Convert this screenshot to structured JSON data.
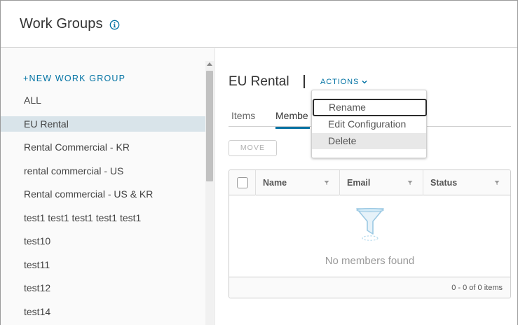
{
  "page": {
    "title": "Work Groups"
  },
  "sidebar": {
    "new_button": "+NEW WORK GROUP",
    "items": [
      {
        "label": "ALL"
      },
      {
        "label": "EU Rental"
      },
      {
        "label": "Rental Commercial - KR"
      },
      {
        "label": "rental commercial - US"
      },
      {
        "label": "Rental commercial - US & KR"
      },
      {
        "label": "test1 test1 test1 test1 test1"
      },
      {
        "label": "test10"
      },
      {
        "label": "test11"
      },
      {
        "label": "test12"
      },
      {
        "label": "test14"
      }
    ],
    "selected_index": 1
  },
  "detail": {
    "title": "EU Rental",
    "actions_label": "ACTIONS",
    "tabs": [
      {
        "label": "Items"
      },
      {
        "label": "Membe"
      }
    ],
    "active_tab_index": 1,
    "move_button": "MOVE",
    "grid": {
      "columns": [
        {
          "label": "Name"
        },
        {
          "label": "Email"
        },
        {
          "label": "Status"
        }
      ],
      "empty_message": "No members found",
      "footer": "0 - 0 of 0 items"
    }
  },
  "actions_menu": {
    "items": [
      {
        "label": "Rename"
      },
      {
        "label": "Edit Configuration"
      },
      {
        "label": "Delete"
      }
    ],
    "focused_index": 0,
    "hovered_index": 2
  },
  "colors": {
    "accent": "#0072a3",
    "selected_row": "#d9e4ea",
    "menu_hover": "#e8e8e8"
  },
  "icons": {
    "info": "info-icon",
    "chevron": "chevron-down-icon",
    "filter": "filter-icon",
    "empty_state": "funnel-icon"
  }
}
